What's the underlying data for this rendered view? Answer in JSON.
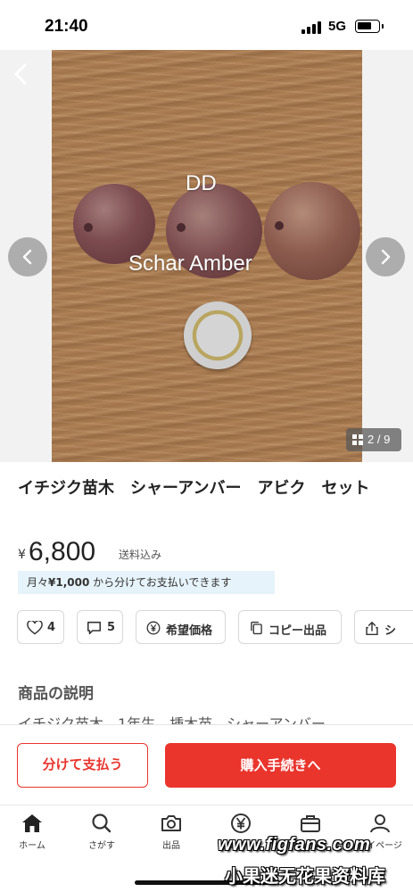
{
  "status_bar": {
    "time": "21:40",
    "network": "5G",
    "signal_icon": "signal-bars-icon",
    "battery_icon": "battery-icon"
  },
  "gallery": {
    "photo_overlay_text": [
      "DD",
      "Schar Amber"
    ],
    "counter": "2 / 9",
    "back_icon": "chevron-left-icon",
    "prev_icon": "chevron-left-icon",
    "next_icon": "chevron-right-icon"
  },
  "product": {
    "title": "イチジク苗木　シャーアンバー　アビク　セット",
    "currency_symbol": "¥",
    "price": "6,800",
    "shipping": "送料込み"
  },
  "installment": {
    "prefix": "月々",
    "amount": "¥1,000",
    "suffix": "から分けてお支払いできます"
  },
  "actions": {
    "like_count": "4",
    "comment_count": "5",
    "offer_label": "希望価格",
    "copy_label": "コピー出品",
    "share_label": "シ"
  },
  "description": {
    "heading": "商品の説明",
    "preview": "イチジク苗木　1年生　挿木苗　シャーアンバー"
  },
  "purchase": {
    "split_pay_label": "分けて支払う",
    "buy_label": "購入手続きへ"
  },
  "tabbar": {
    "items": [
      {
        "label": "ホーム",
        "icon": "home-icon"
      },
      {
        "label": "さがす",
        "icon": "search-icon"
      },
      {
        "label": "出品",
        "icon": "camera-icon"
      },
      {
        "label": "支払い",
        "icon": "yen-icon"
      },
      {
        "label": "持ち物",
        "icon": "bag-icon"
      },
      {
        "label": "マイページ",
        "icon": "person-icon"
      }
    ]
  },
  "watermark": {
    "url": "www.figfans.com",
    "caption": "小果迷无花果资料库"
  },
  "colors": {
    "accent": "#ea352d",
    "installment_bg": "#e6f3fa"
  }
}
